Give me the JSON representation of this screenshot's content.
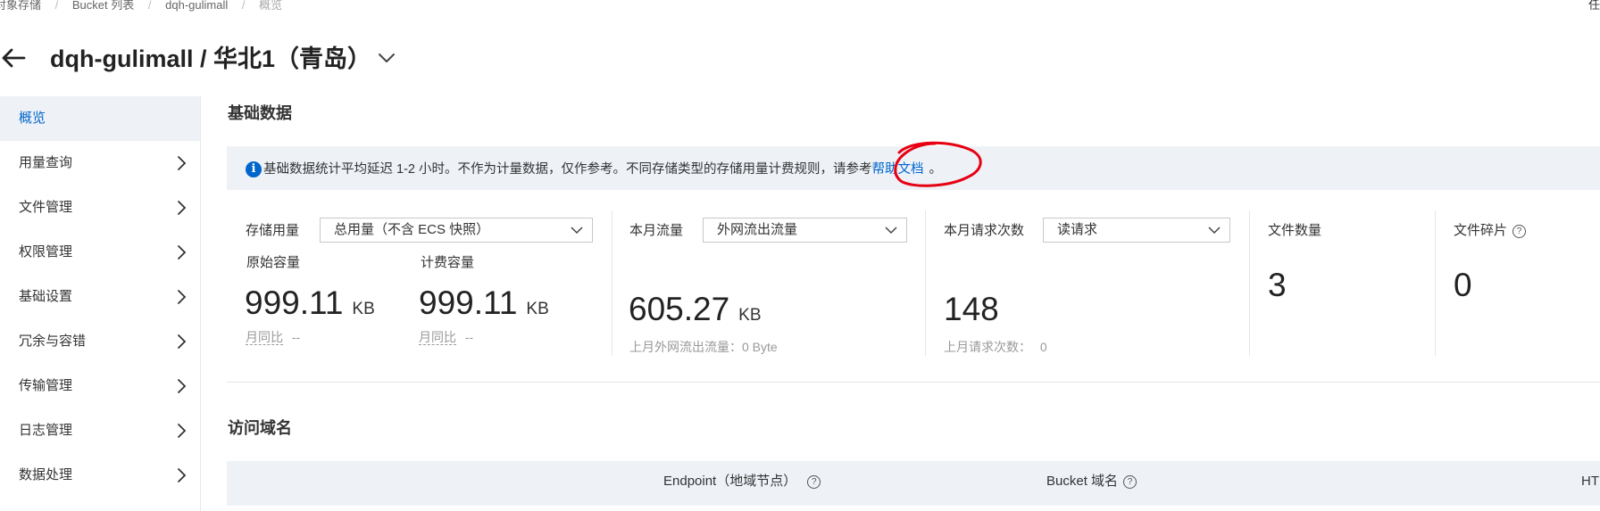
{
  "breadcrumb": {
    "items": [
      "对象存储",
      "Bucket 列表",
      "dqh-gulimall",
      "概览"
    ],
    "separator": "/"
  },
  "topright_text": "任",
  "header": {
    "title": "dqh-gulimall / 华北1（青岛）"
  },
  "sidebar": {
    "items": [
      {
        "label": "概览",
        "active": true
      },
      {
        "label": "用量查询"
      },
      {
        "label": "文件管理"
      },
      {
        "label": "权限管理"
      },
      {
        "label": "基础设置"
      },
      {
        "label": "冗余与容错"
      },
      {
        "label": "传输管理"
      },
      {
        "label": "日志管理"
      },
      {
        "label": "数据处理"
      }
    ]
  },
  "basic_data": {
    "title": "基础数据",
    "notice_text": "基础数据统计平均延迟 1-2 小时。不作为计量数据，仅作参考。不同存储类型的存储用量计费规则，请参考",
    "notice_link": "帮助文档",
    "notice_tail": "。"
  },
  "metrics": {
    "storage": {
      "label": "存储用量",
      "select_value": "总用量（不含 ECS 快照）",
      "raw_label": "原始容量",
      "raw_value": "999.11",
      "raw_unit": "KB",
      "raw_mom": "月同比",
      "raw_mom_value": "--",
      "billed_label": "计费容量",
      "billed_value": "999.11",
      "billed_unit": "KB",
      "billed_mom": "月同比",
      "billed_mom_value": "--"
    },
    "traffic": {
      "label": "本月流量",
      "select_value": "外网流出流量",
      "value": "605.27",
      "unit": "KB",
      "last_month": "上月外网流出流量：0 Byte"
    },
    "requests": {
      "label": "本月请求次数",
      "select_value": "读请求",
      "value": "148",
      "last_month_label": "上月请求次数：",
      "last_month_value": "0"
    },
    "files": {
      "label": "文件数量",
      "value": "3"
    },
    "fragments": {
      "label": "文件碎片",
      "value": "0",
      "help": "?"
    }
  },
  "domains": {
    "title": "访问域名",
    "columns": [
      "Endpoint（地域节点）",
      "Bucket 域名",
      "HT"
    ],
    "help": "?"
  },
  "colors": {
    "accent": "#0066cc",
    "annotation": "#e60012",
    "notice_bg": "#eef2f7"
  }
}
